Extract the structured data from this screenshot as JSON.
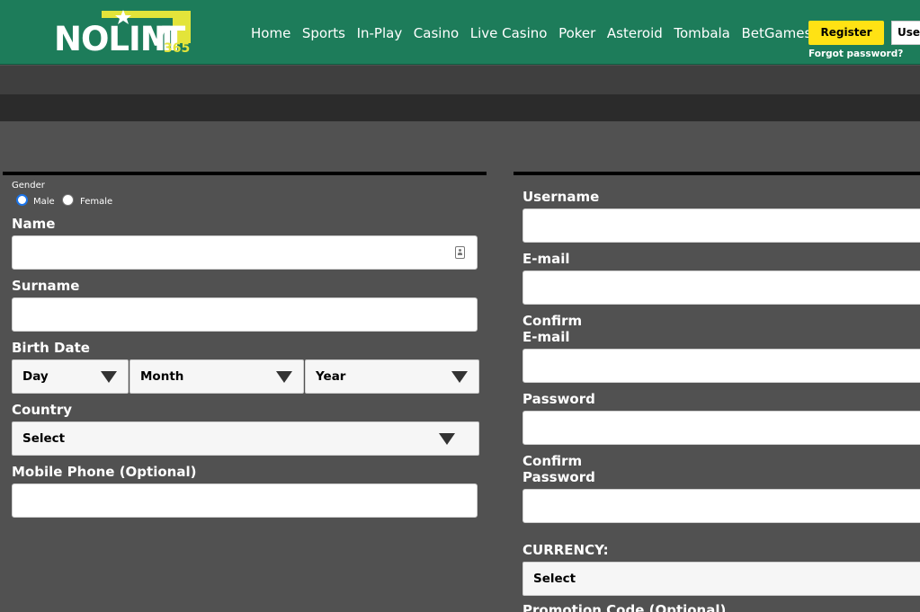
{
  "header": {
    "logo": {
      "text": "NOLIMIT",
      "badge": "365"
    },
    "nav": [
      "Home",
      "Sports",
      "In-Play",
      "Casino",
      "Live Casino",
      "Poker",
      "Asteroid",
      "Tombala",
      "BetGames.tv"
    ],
    "register_label": "Register",
    "user_field_text": "User",
    "forgot_password": "Forgot password?"
  },
  "left_form": {
    "gender_label": "Gender",
    "gender_options": [
      "Male",
      "Female"
    ],
    "gender_selected": "Male",
    "name_label": "Name",
    "surname_label": "Surname",
    "birth_label": "Birth Date",
    "birth_day": "Day",
    "birth_month": "Month",
    "birth_year": "Year",
    "country_label": "Country",
    "country_value": "Select",
    "phone_label": "Mobile Phone (Optional)"
  },
  "right_form": {
    "username_label": "Username",
    "email_label": "E-mail",
    "confirm_email_label_1": "Confirm",
    "confirm_email_label_2": "E-mail",
    "password_label": "Password",
    "confirm_password_label_1": "Confirm",
    "confirm_password_label_2": "Password",
    "currency_label": "CURRENCY:",
    "currency_value": "Select",
    "promo_label": "Promotion Code (Optional)"
  },
  "colors": {
    "header_bg": "#1d7c5a",
    "page_bg": "#515151",
    "register_bg": "#ffe214",
    "logo_yellow": "#e3e43a"
  },
  "icons": [
    "star-icon",
    "contact-card-icon",
    "chevron-down-icon"
  ]
}
